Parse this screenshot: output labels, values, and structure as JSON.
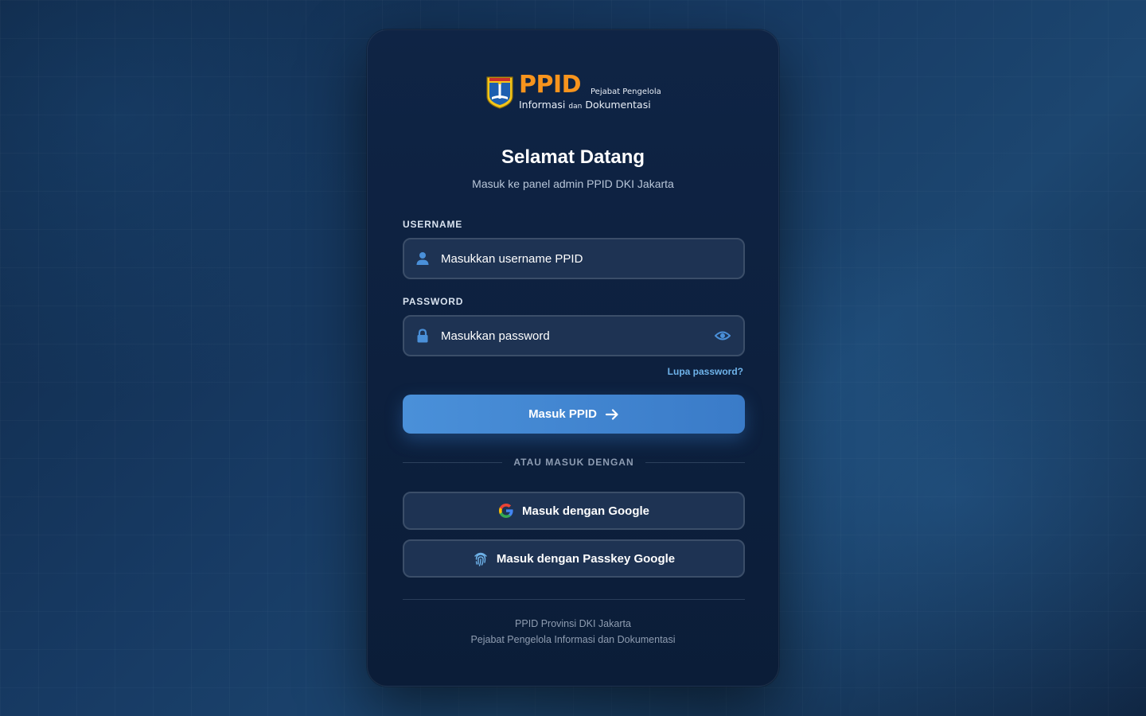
{
  "brand": {
    "logo_main": "PPID",
    "logo_sub1": "Pejabat Pengelola",
    "logo_sub2_a": "Informasi",
    "logo_sub2_dan": "dan",
    "logo_sub2_b": "Dokumentasi",
    "accent_color": "#f7941d"
  },
  "header": {
    "title": "Selamat Datang",
    "subtitle": "Masuk ke panel admin PPID DKI Jakarta"
  },
  "form": {
    "username_label": "USERNAME",
    "username_placeholder": "Masukkan username PPID",
    "username_value": "",
    "password_label": "PASSWORD",
    "password_placeholder": "Masukkan password",
    "password_value": "",
    "forgot_label": "Lupa password?",
    "submit_label": "Masuk PPID"
  },
  "divider": {
    "text": "ATAU MASUK DENGAN"
  },
  "oauth": {
    "google_label": "Masuk dengan Google",
    "passkey_label": "Masuk dengan Passkey Google"
  },
  "footer": {
    "line1": "PPID Provinsi DKI Jakarta",
    "line2": "Pejabat Pengelola Informasi dan Dokumentasi"
  },
  "icons": {
    "username": "user-icon",
    "password": "lock-icon",
    "toggle": "eye-icon",
    "submit": "arrow-right-icon",
    "google": "google-icon",
    "passkey": "fingerprint-icon"
  },
  "colors": {
    "primary": "#4a90d9",
    "link": "#6fb3ea",
    "card_bg": "#0f2445"
  }
}
